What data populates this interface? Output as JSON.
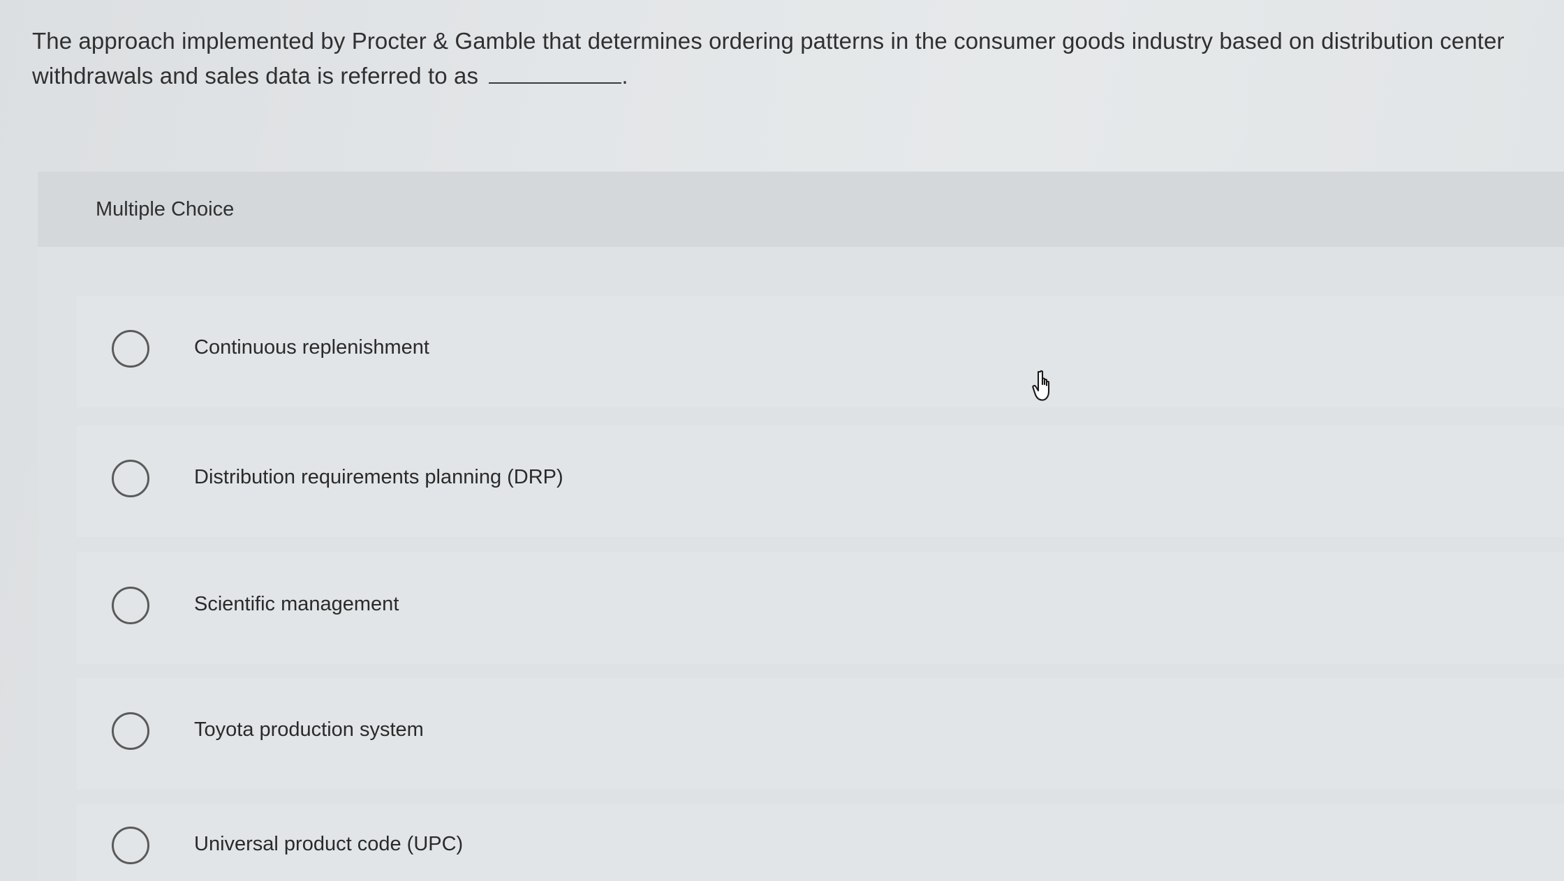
{
  "question": {
    "text": "The approach implemented by Procter & Gamble that determines ordering patterns in the consumer goods industry based on distribution center withdrawals and sales data is referred to as",
    "trailing_punctuation": "."
  },
  "section": {
    "label": "Multiple Choice"
  },
  "options": [
    {
      "label": "Continuous replenishment",
      "selected": false
    },
    {
      "label": "Distribution requirements planning (DRP)",
      "selected": false
    },
    {
      "label": "Scientific management",
      "selected": false
    },
    {
      "label": "Toyota production system",
      "selected": false
    },
    {
      "label": "Universal product code (UPC)",
      "selected": false
    }
  ],
  "icons": {
    "radio": "radio-unselected-icon",
    "cursor": "hand-pointer-icon"
  },
  "colors": {
    "page_background": "#e3e6e8",
    "header_band": "#d5d8da",
    "text": "#2b2b2b",
    "radio_border": "#5a5a5a"
  }
}
